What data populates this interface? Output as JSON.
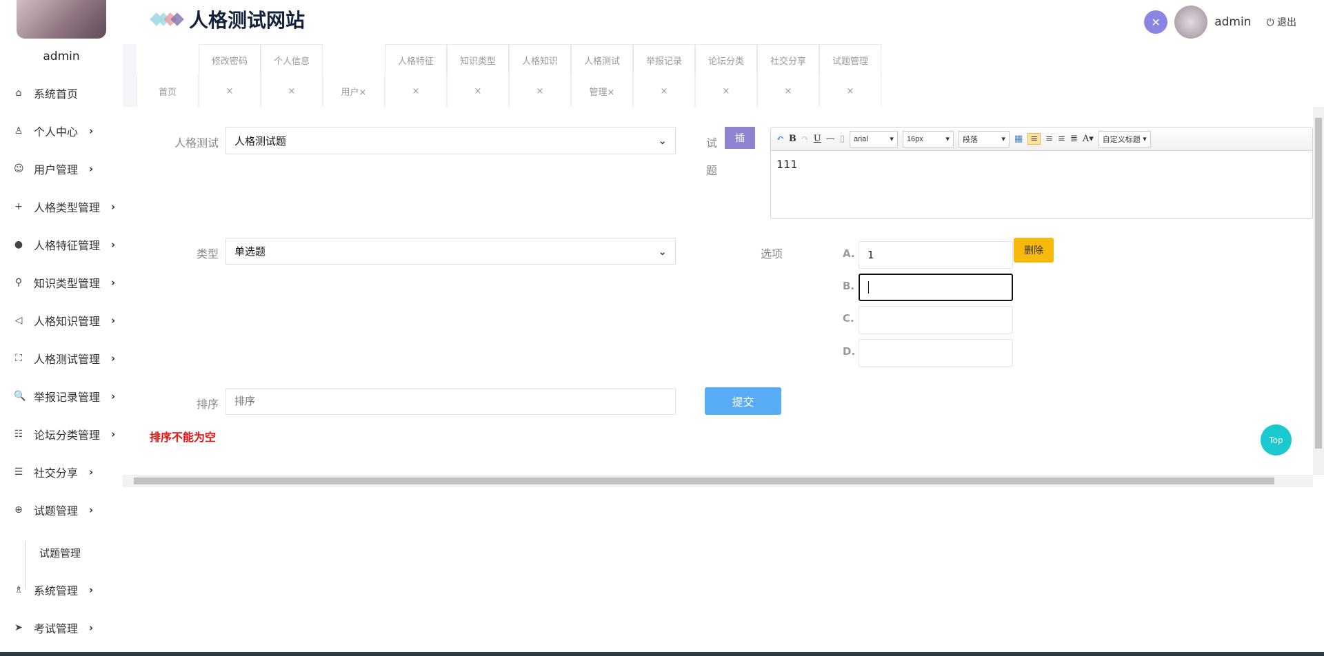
{
  "sidebar": {
    "username": "admin",
    "items": [
      {
        "label": "系统首页",
        "icon": "home-icon",
        "glyph": "⌂",
        "chevron": false
      },
      {
        "label": "个人中心",
        "icon": "user-icon",
        "glyph": "♙",
        "chevron": true
      },
      {
        "label": "用户管理",
        "icon": "smile-icon",
        "glyph": "☺",
        "chevron": true
      },
      {
        "label": "人格类型管理",
        "icon": "plus-icon",
        "glyph": "+",
        "chevron": true
      },
      {
        "label": "人格特征管理",
        "icon": "user-circle-icon",
        "glyph": "●",
        "chevron": true
      },
      {
        "label": "知识类型管理",
        "icon": "search-icon",
        "glyph": "⚲",
        "chevron": true
      },
      {
        "label": "人格知识管理",
        "icon": "speaker-icon",
        "glyph": "◁",
        "chevron": true
      },
      {
        "label": "人格测试管理",
        "icon": "scan-face-icon",
        "glyph": "⛶",
        "chevron": true
      },
      {
        "label": "举报记录管理",
        "icon": "magnify-icon",
        "glyph": "🔍",
        "chevron": true
      },
      {
        "label": "论坛分类管理",
        "icon": "category-icon",
        "glyph": "☷",
        "chevron": true
      },
      {
        "label": "社交分享",
        "icon": "list-icon",
        "glyph": "☰",
        "chevron": true
      },
      {
        "label": "试题管理",
        "icon": "zoom-in-icon",
        "glyph": "⊕",
        "chevron": true
      },
      {
        "label": "系统管理",
        "icon": "users-icon",
        "glyph": "♗",
        "chevron": true
      },
      {
        "label": "考试管理",
        "icon": "send-icon",
        "glyph": "➤",
        "chevron": true
      }
    ],
    "submenu": {
      "label": "试题管理"
    },
    "chevron": "›"
  },
  "header": {
    "title": "人格测试网站",
    "username": "admin",
    "logout": "退出",
    "logout_icon": "⏻",
    "fullscreen_icon": "✕"
  },
  "tabs": [
    {
      "top": "",
      "bottom": "首页"
    },
    {
      "top": "修改密码",
      "bottom": "×"
    },
    {
      "top": "个人信息",
      "bottom": "×"
    },
    {
      "top": "",
      "bottom": "用户×"
    },
    {
      "top": "人格特征",
      "bottom": "×"
    },
    {
      "top": "知识类型",
      "bottom": "×"
    },
    {
      "top": "人格知识",
      "bottom": "×"
    },
    {
      "top": "人格测试",
      "bottom": "管理×"
    },
    {
      "top": "举报记录",
      "bottom": "×"
    },
    {
      "top": "论坛分类",
      "bottom": "×"
    },
    {
      "top": "社交分享",
      "bottom": "×"
    },
    {
      "top": "试题管理",
      "bottom": "×"
    }
  ],
  "form": {
    "test_label": "人格测试",
    "test_value": "人格测试题",
    "question_label_1": "试",
    "question_label_2": "题",
    "insert_button": "插",
    "editor": {
      "font": "arial",
      "size": "16px",
      "paragraph": "段落",
      "heading": "自定义标题",
      "content": "111"
    },
    "type_label": "类型",
    "type_value": "单选题",
    "options_label": "选项",
    "options": [
      {
        "letter": "A.",
        "value": "1"
      },
      {
        "letter": "B.",
        "value": ""
      },
      {
        "letter": "C.",
        "value": ""
      },
      {
        "letter": "D.",
        "value": ""
      }
    ],
    "delete_button": "删除",
    "sort_label": "排序",
    "sort_placeholder": "排序",
    "submit_button": "提交",
    "error": "排序不能为空"
  },
  "top_button": "Top",
  "colors": {
    "insert": "#8d84cf",
    "delete": "#f7b90b",
    "submit": "#58acf6",
    "error": "#e0120f",
    "top": "#19c9cf"
  }
}
